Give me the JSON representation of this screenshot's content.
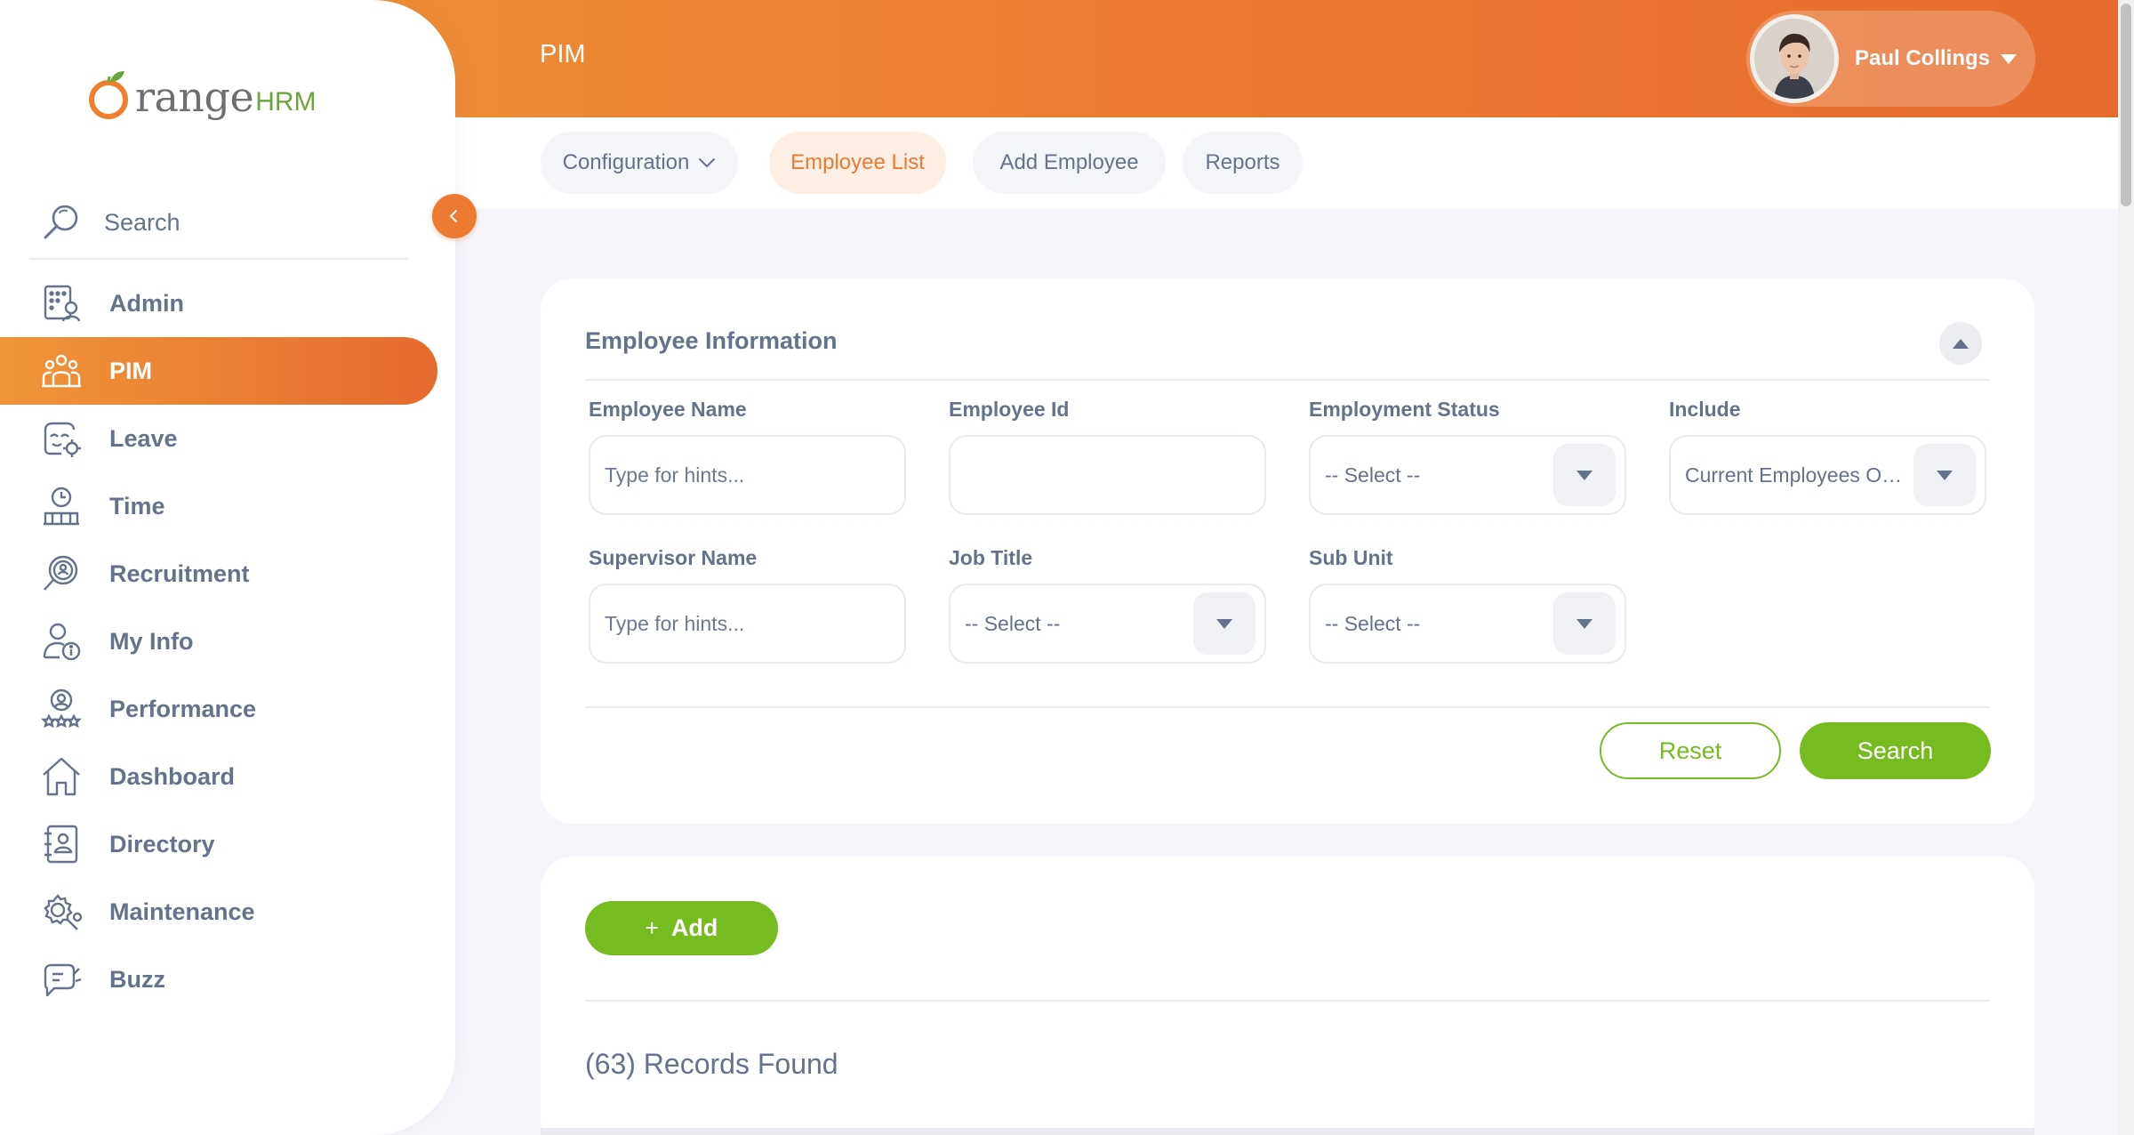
{
  "app": {
    "logo_main": "range",
    "logo_suffix": "HRM",
    "brand_color": "#ec7a30",
    "accent_green": "#76bc21"
  },
  "header": {
    "title": "PIM",
    "user_name": "Paul Collings"
  },
  "sidebar": {
    "search_label": "Search",
    "items": [
      {
        "label": "Admin",
        "icon": "admin-icon",
        "active": false
      },
      {
        "label": "PIM",
        "icon": "pim-icon",
        "active": true
      },
      {
        "label": "Leave",
        "icon": "leave-icon",
        "active": false
      },
      {
        "label": "Time",
        "icon": "time-icon",
        "active": false
      },
      {
        "label": "Recruitment",
        "icon": "recruitment-icon",
        "active": false
      },
      {
        "label": "My Info",
        "icon": "my-info-icon",
        "active": false
      },
      {
        "label": "Performance",
        "icon": "performance-icon",
        "active": false
      },
      {
        "label": "Dashboard",
        "icon": "dashboard-icon",
        "active": false
      },
      {
        "label": "Directory",
        "icon": "directory-icon",
        "active": false
      },
      {
        "label": "Maintenance",
        "icon": "maintenance-icon",
        "active": false
      },
      {
        "label": "Buzz",
        "icon": "buzz-icon",
        "active": false
      }
    ]
  },
  "tabs": [
    {
      "label": "Configuration",
      "has_dropdown": true,
      "active": false
    },
    {
      "label": "Employee List",
      "active": true
    },
    {
      "label": "Add Employee",
      "active": false
    },
    {
      "label": "Reports",
      "active": false
    }
  ],
  "filter": {
    "title": "Employee Information",
    "employee_name": {
      "label": "Employee Name",
      "placeholder": "Type for hints...",
      "value": ""
    },
    "employee_id": {
      "label": "Employee Id",
      "value": ""
    },
    "employment_status": {
      "label": "Employment Status",
      "selected": "-- Select --"
    },
    "include": {
      "label": "Include",
      "selected": "Current Employees Only"
    },
    "supervisor_name": {
      "label": "Supervisor Name",
      "placeholder": "Type for hints...",
      "value": ""
    },
    "job_title": {
      "label": "Job Title",
      "selected": "-- Select --"
    },
    "sub_unit": {
      "label": "Sub Unit",
      "selected": "-- Select --"
    },
    "reset_label": "Reset",
    "search_label": "Search"
  },
  "list": {
    "add_plus": "+",
    "add_label": "Add",
    "records_found": "(63) Records Found"
  }
}
